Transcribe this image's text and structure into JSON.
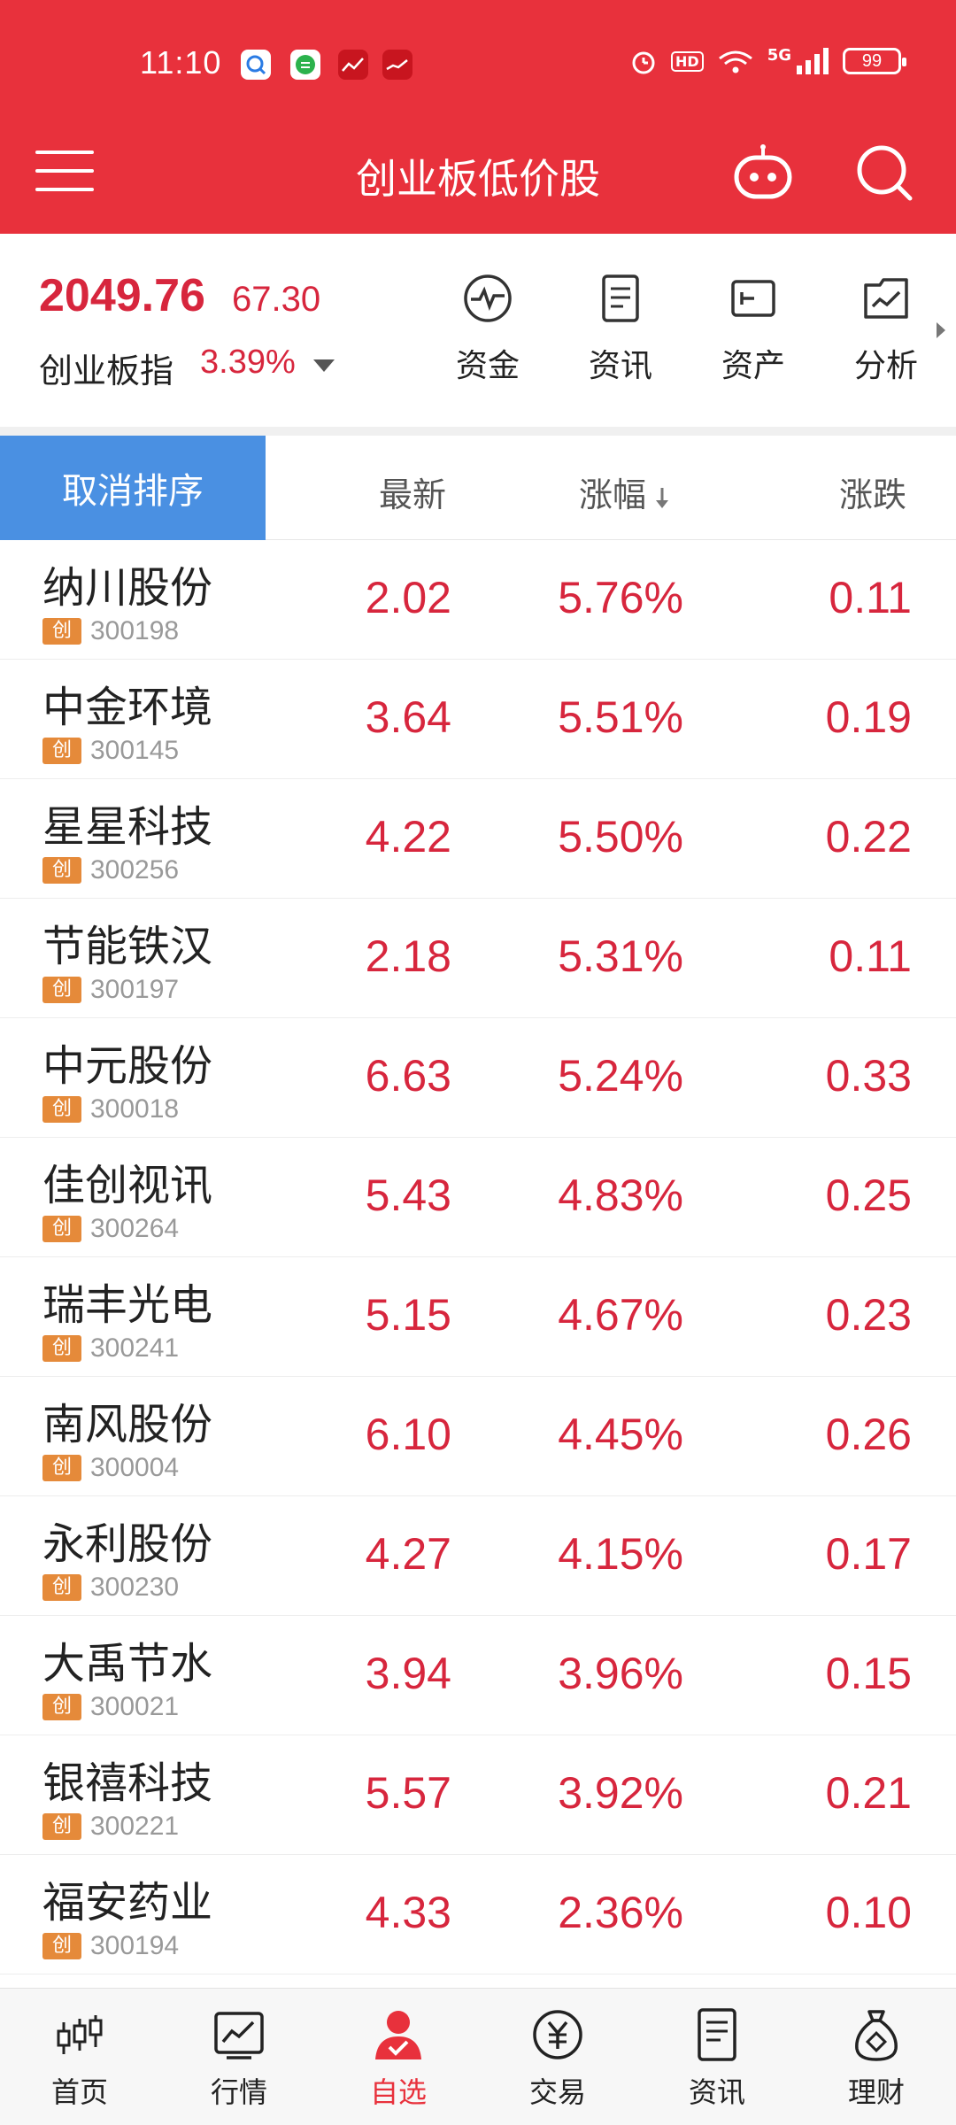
{
  "status_bar": {
    "time": "11:10",
    "battery": "99",
    "hd": "HD",
    "network": "5G"
  },
  "header": {
    "title": "创业板低价股"
  },
  "index": {
    "price": "2049.76",
    "change": "67.30",
    "name": "创业板指",
    "pct": "3.39%",
    "quick_links": [
      {
        "label": "资金",
        "icon": "pulse-icon"
      },
      {
        "label": "资讯",
        "icon": "document-icon"
      },
      {
        "label": "资产",
        "icon": "wallet-icon"
      },
      {
        "label": "分析",
        "icon": "chart-folder-icon"
      }
    ]
  },
  "table": {
    "cancel_sort": "取消排序",
    "col_latest": "最新",
    "col_pct": "涨幅",
    "col_change": "涨跌",
    "badge": "创",
    "rows": [
      {
        "name": "纳川股份",
        "code": "300198",
        "price": "2.02",
        "pct": "5.76%",
        "chg": "0.11"
      },
      {
        "name": "中金环境",
        "code": "300145",
        "price": "3.64",
        "pct": "5.51%",
        "chg": "0.19"
      },
      {
        "name": "星星科技",
        "code": "300256",
        "price": "4.22",
        "pct": "5.50%",
        "chg": "0.22"
      },
      {
        "name": "节能铁汉",
        "code": "300197",
        "price": "2.18",
        "pct": "5.31%",
        "chg": "0.11"
      },
      {
        "name": "中元股份",
        "code": "300018",
        "price": "6.63",
        "pct": "5.24%",
        "chg": "0.33"
      },
      {
        "name": "佳创视讯",
        "code": "300264",
        "price": "5.43",
        "pct": "4.83%",
        "chg": "0.25"
      },
      {
        "name": "瑞丰光电",
        "code": "300241",
        "price": "5.15",
        "pct": "4.67%",
        "chg": "0.23"
      },
      {
        "name": "南风股份",
        "code": "300004",
        "price": "6.10",
        "pct": "4.45%",
        "chg": "0.26"
      },
      {
        "name": "永利股份",
        "code": "300230",
        "price": "4.27",
        "pct": "4.15%",
        "chg": "0.17"
      },
      {
        "name": "大禹节水",
        "code": "300021",
        "price": "3.94",
        "pct": "3.96%",
        "chg": "0.15"
      },
      {
        "name": "银禧科技",
        "code": "300221",
        "price": "5.57",
        "pct": "3.92%",
        "chg": "0.21"
      },
      {
        "name": "福安药业",
        "code": "300194",
        "price": "4.33",
        "pct": "2.36%",
        "chg": "0.10"
      }
    ]
  },
  "bottom_nav": [
    {
      "label": "首页",
      "icon": "candlestick-icon"
    },
    {
      "label": "行情",
      "icon": "trend-chart-icon"
    },
    {
      "label": "自选",
      "icon": "user-check-icon"
    },
    {
      "label": "交易",
      "icon": "yuan-icon"
    },
    {
      "label": "资讯",
      "icon": "news-icon"
    },
    {
      "label": "理财",
      "icon": "money-bag-icon"
    }
  ],
  "colors": {
    "brand": "#E8313C",
    "up": "#D7263D",
    "sort_button": "#4A90E2",
    "badge": "#E58A3A"
  }
}
